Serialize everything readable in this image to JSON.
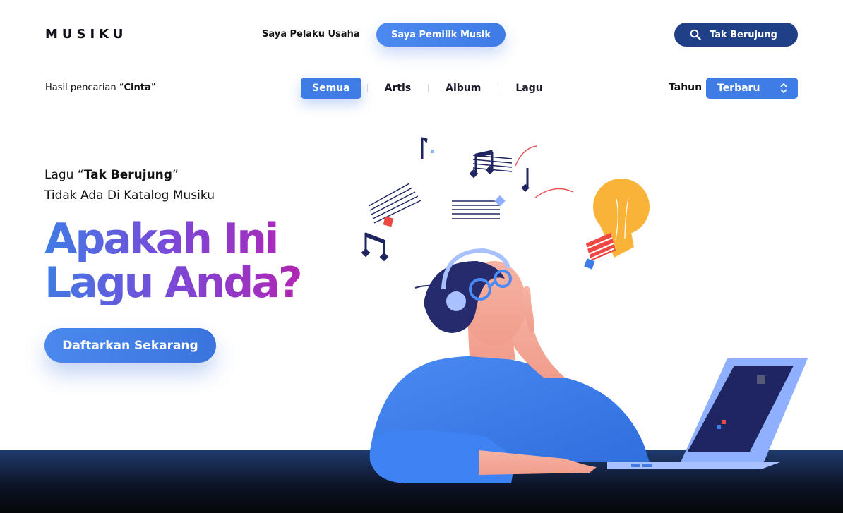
{
  "header": {
    "logo": "MUSIKU",
    "nav_business": "Saya Pelaku Usaha",
    "nav_owner": "Saya Pemilik Musik",
    "search_value": "Tak Berujung"
  },
  "filter_bar": {
    "result_prefix": "Hasil pencarian “",
    "result_query": "Cinta",
    "result_suffix": "”",
    "tabs": [
      {
        "label": "Semua",
        "active": true
      },
      {
        "label": "Artis",
        "active": false
      },
      {
        "label": "Album",
        "active": false
      },
      {
        "label": "Lagu",
        "active": false
      }
    ],
    "year_label": "Tahun",
    "year_selected": "Terbaru"
  },
  "hero": {
    "line1_prefix": "Lagu “",
    "song_title": "Tak Berujung",
    "line1_suffix": "”",
    "line2": "Tidak Ada Di Katalog Musiku",
    "headline_line1": "Apakah Ini",
    "headline_line2": "Lagu Anda?",
    "cta_label": "Daftarkan Sekarang"
  },
  "colors": {
    "accent": "#3f7ce6",
    "navy": "#1f3f86",
    "gradient_end": "#c31ba8"
  },
  "icons": [
    "search-icon",
    "chevron-updown-icon"
  ]
}
